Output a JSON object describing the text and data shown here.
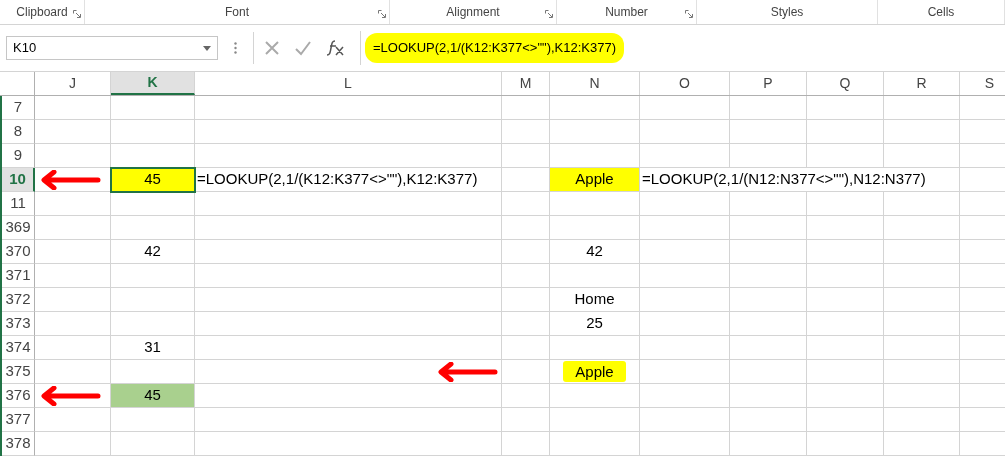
{
  "ribbon_groups": [
    {
      "label": "Clipboard",
      "launcher": true
    },
    {
      "label": "Font",
      "launcher": true
    },
    {
      "label": "Alignment",
      "launcher": true
    },
    {
      "label": "Number",
      "launcher": true
    },
    {
      "label": "Styles",
      "launcher": false
    },
    {
      "label": "Cells",
      "launcher": false
    }
  ],
  "name_box": {
    "value": "K10"
  },
  "formula_bar": {
    "value": "=LOOKUP(2,1/(K12:K377<>\"\"),K12:K377)",
    "highlighted": true
  },
  "columns": [
    {
      "label": "J",
      "selected": false
    },
    {
      "label": "K",
      "selected": true
    },
    {
      "label": "L",
      "selected": false
    },
    {
      "label": "M",
      "selected": false
    },
    {
      "label": "N",
      "selected": false
    },
    {
      "label": "O",
      "selected": false
    },
    {
      "label": "P",
      "selected": false
    },
    {
      "label": "Q",
      "selected": false
    },
    {
      "label": "R",
      "selected": false
    },
    {
      "label": "S",
      "selected": false
    }
  ],
  "rows": [
    {
      "label": "7",
      "selected": false,
      "cells": {}
    },
    {
      "label": "8",
      "selected": false,
      "cells": {}
    },
    {
      "label": "9",
      "selected": false,
      "cells": {}
    },
    {
      "label": "10",
      "selected": true,
      "cells": {
        "J": {
          "kind": "arrow"
        },
        "K": {
          "kind": "text",
          "text": "45",
          "color": "#ffff00",
          "selected": true
        },
        "L": {
          "kind": "overflow",
          "text": "=LOOKUP(2,1/(K12:K377<>\"\"),K12:K377)"
        },
        "N": {
          "kind": "text",
          "text": "Apple",
          "color": "#ffff00"
        },
        "O": {
          "kind": "overflow",
          "text": "=LOOKUP(2,1/(N12:N377<>\"\"),N12:N377)"
        }
      }
    },
    {
      "label": "11",
      "selected": false,
      "cells": {}
    },
    {
      "label": "369",
      "selected": false,
      "cells": {}
    },
    {
      "label": "370",
      "selected": false,
      "cells": {
        "K": {
          "kind": "text",
          "text": "42"
        },
        "N": {
          "kind": "text",
          "text": "42"
        }
      }
    },
    {
      "label": "371",
      "selected": false,
      "cells": {}
    },
    {
      "label": "372",
      "selected": false,
      "cells": {
        "N": {
          "kind": "text",
          "text": "Home"
        }
      }
    },
    {
      "label": "373",
      "selected": false,
      "cells": {
        "N": {
          "kind": "text",
          "text": "25"
        }
      }
    },
    {
      "label": "374",
      "selected": false,
      "cells": {
        "K": {
          "kind": "text",
          "text": "31"
        }
      }
    },
    {
      "label": "375",
      "selected": false,
      "cells": {
        "L": {
          "kind": "arrow"
        },
        "N": {
          "kind": "text",
          "text": "Apple",
          "marker": true
        }
      }
    },
    {
      "label": "376",
      "selected": false,
      "cells": {
        "J": {
          "kind": "arrow"
        },
        "K": {
          "kind": "text",
          "text": "45",
          "color": "#a9d08e"
        }
      }
    },
    {
      "label": "377",
      "selected": false,
      "cells": {}
    },
    {
      "label": "378",
      "selected": false,
      "cells": {}
    }
  ]
}
